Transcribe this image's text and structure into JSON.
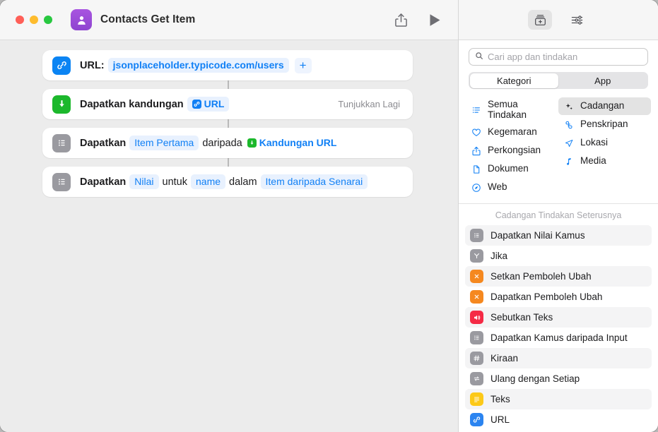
{
  "window": {
    "title": "Contacts Get Item",
    "app_icon": "contacts-icon",
    "traffic_lights": [
      "close",
      "minimize",
      "zoom"
    ],
    "toolbar": {
      "share_label": "share-icon",
      "run_label": "play-icon"
    }
  },
  "workflow": {
    "actions": [
      {
        "icon": "link-icon",
        "icon_color": "#0b84f3",
        "label": "URL:",
        "value_token": "jsonplaceholder.typicode.com/users",
        "add_label": "+"
      },
      {
        "icon": "download-icon",
        "icon_color": "#1cb82c",
        "label": "Dapatkan kandungan",
        "value_token": "URL",
        "trailing": "Tunjukkan Lagi"
      },
      {
        "icon": "list-icon",
        "icon_color": "#9a9aa0",
        "label": "Dapatkan",
        "token1": "Item Pertama",
        "mid": "daripada",
        "token2": "Kandungan URL"
      },
      {
        "icon": "list-icon",
        "icon_color": "#9a9aa0",
        "label": "Dapatkan",
        "token1": "Nilai",
        "mid1": "untuk",
        "token2": "name",
        "mid2": "dalam",
        "token3": "Item daripada Senarai"
      }
    ]
  },
  "sidebar": {
    "toolbar": {
      "library_icon": "action-library-icon",
      "settings_icon": "sliders-icon"
    },
    "search": {
      "placeholder": "Cari app dan tindakan",
      "value": "",
      "icon": "search-icon"
    },
    "segmented": {
      "options": [
        "Kategori",
        "App"
      ],
      "selected": "Kategori"
    },
    "categories": {
      "column_left": [
        {
          "label": "Semua Tindakan",
          "icon": "list-bullet-icon",
          "selected": false
        },
        {
          "label": "Kegemaran",
          "icon": "heart-icon",
          "selected": false
        },
        {
          "label": "Perkongsian",
          "icon": "share-icon",
          "selected": false
        },
        {
          "label": "Dokumen",
          "icon": "document-icon",
          "selected": false
        },
        {
          "label": "Web",
          "icon": "compass-icon",
          "selected": false
        }
      ],
      "column_right": [
        {
          "label": "Cadangan",
          "icon": "sparkles-icon",
          "selected": true
        },
        {
          "label": "Penskripan",
          "icon": "scroll-icon",
          "selected": false
        },
        {
          "label": "Lokasi",
          "icon": "location-arrow-icon",
          "selected": false
        },
        {
          "label": "Media",
          "icon": "music-note-icon",
          "selected": false
        }
      ]
    },
    "suggestions": {
      "header": "Cadangan Tindakan Seterusnya",
      "items": [
        {
          "label": "Dapatkan Nilai Kamus",
          "icon": "dictionary-icon",
          "color": "gray"
        },
        {
          "label": "Jika",
          "icon": "branch-icon",
          "color": "gray"
        },
        {
          "label": "Setkan Pemboleh Ubah",
          "icon": "variable-icon",
          "color": "orange"
        },
        {
          "label": "Dapatkan Pemboleh Ubah",
          "icon": "variable-icon",
          "color": "orange"
        },
        {
          "label": "Sebutkan Teks",
          "icon": "speaker-icon",
          "color": "red"
        },
        {
          "label": "Dapatkan Kamus daripada Input",
          "icon": "dictionary-icon",
          "color": "gray"
        },
        {
          "label": "Kiraan",
          "icon": "hash-icon",
          "color": "gray"
        },
        {
          "label": "Ulang dengan Setiap",
          "icon": "repeat-icon",
          "color": "gray"
        },
        {
          "label": "Teks",
          "icon": "text-icon",
          "color": "yellow"
        },
        {
          "label": "URL",
          "icon": "link-icon",
          "color": "blue"
        }
      ]
    }
  },
  "colors": {
    "accent_blue": "#1180f5",
    "green": "#1cb82c",
    "orange": "#f5881f",
    "red": "#f52a45",
    "yellow": "#fcc918",
    "gray_icon": "#9a9aa0",
    "canvas_bg": "#ececec"
  }
}
